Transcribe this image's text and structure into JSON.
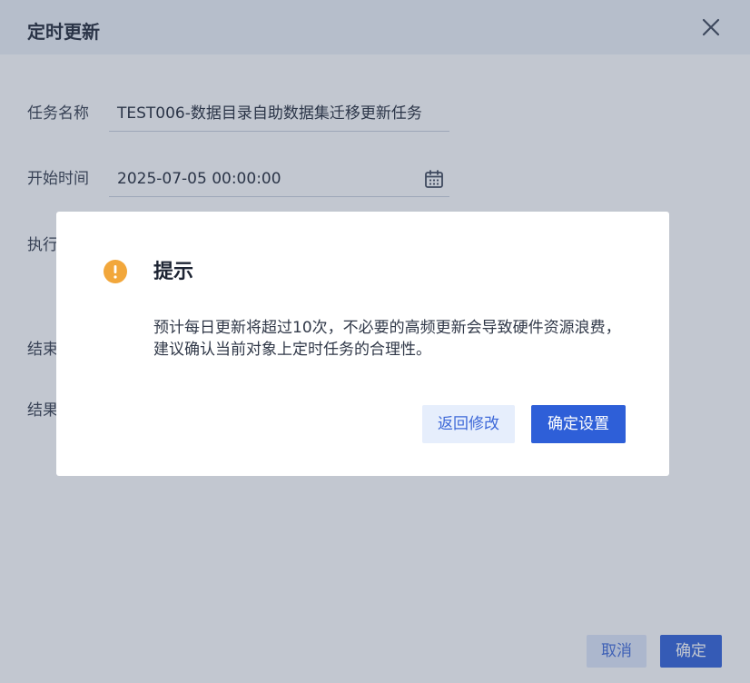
{
  "dialog": {
    "title": "定时更新",
    "fields": {
      "task_name": {
        "label": "任务名称",
        "value": "TEST006-数据目录自助数据集迁移更新任务"
      },
      "start_time": {
        "label": "开始时间",
        "value": "2025-07-05 00:00:00"
      },
      "execute": {
        "label": "执行"
      },
      "end_a": {
        "label": "结束"
      },
      "end_b": {
        "label": "结果"
      }
    },
    "footer": {
      "cancel_label": "取消",
      "confirm_label": "确定"
    }
  },
  "modal": {
    "title": "提示",
    "message": "预计每日更新将超过10次，不必要的高频更新会导致硬件资源浪费，建议确认当前对象上定时任务的合理性。",
    "back_label": "返回修改",
    "ok_label": "确定设置",
    "icon": "warning-icon"
  },
  "colors": {
    "accent": "#2e5fd8",
    "warning": "#f2a73b",
    "overlay": "#465670"
  }
}
